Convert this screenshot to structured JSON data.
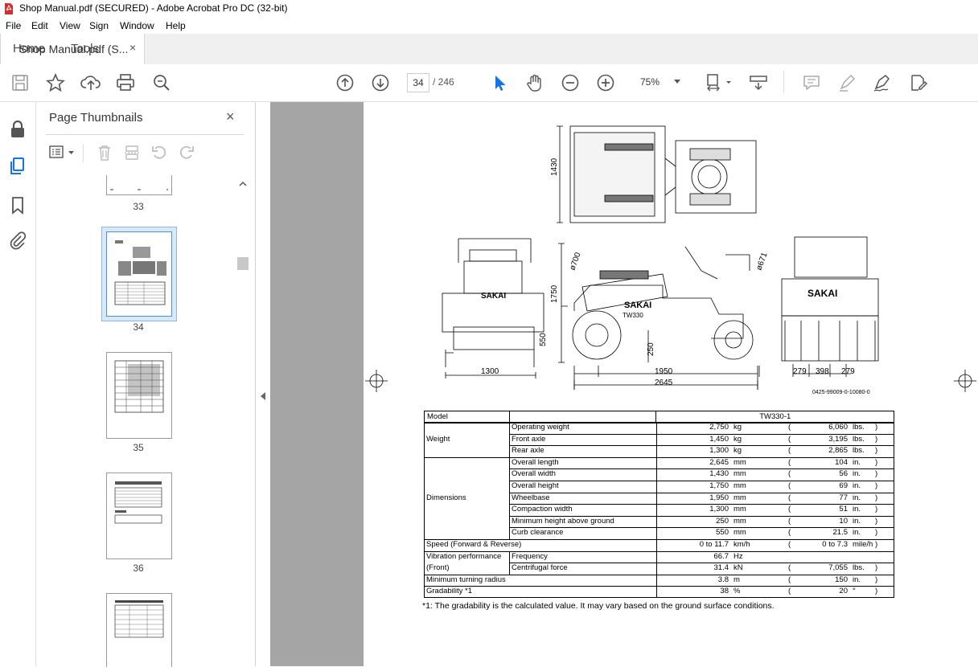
{
  "window": {
    "title": "Shop Manual.pdf (SECURED) - Adobe Acrobat Pro DC (32-bit)"
  },
  "menu": [
    "File",
    "Edit",
    "View",
    "Sign",
    "Window",
    "Help"
  ],
  "tabs": {
    "home": "Home",
    "tools": "Tools",
    "document": "Shop Manual.pdf (S...",
    "close": "×"
  },
  "toolbar": {
    "icons": [
      "save-icon",
      "star-icon",
      "upload-icon",
      "print-icon",
      "search-zoom-icon",
      "page-up-icon",
      "page-down-icon",
      "select-cursor-icon",
      "hand-icon",
      "zoom-out-icon",
      "zoom-in-icon",
      "fit-page-icon",
      "scroll-mode-icon",
      "comment-icon",
      "highlight-icon",
      "sign-icon",
      "share-icon"
    ],
    "current_page": "34",
    "total_pages": "/ 246",
    "zoom": "75%"
  },
  "thumbnails_panel": {
    "title": "Page Thumbnails",
    "close": "×",
    "pages": [
      "33",
      "34",
      "35",
      "36"
    ],
    "selected_page": "34"
  },
  "document": {
    "drawing": {
      "dims": {
        "d1430": "1430",
        "d1750": "1750",
        "d550": "550",
        "d250": "250",
        "d1300": "1300",
        "d1950": "1950",
        "d2645": "2645",
        "d279a": "279",
        "d398": "398",
        "d279b": "279",
        "d700": "ø700",
        "d671": "ø671"
      },
      "brand": "SAKAI",
      "model_mark": "TW330",
      "ref": "0425-99009-0-10080-0"
    },
    "spec_table": {
      "header": {
        "label": "Model",
        "value": "TW330-1"
      },
      "rows": [
        {
          "group": "Weight",
          "item": "Operating weight",
          "value": "2,750",
          "unit": "kg",
          "paren_value": "6,060",
          "paren_unit": "lbs."
        },
        {
          "group": "",
          "item": "Front axle",
          "value": "1,450",
          "unit": "kg",
          "paren_value": "3,195",
          "paren_unit": "lbs."
        },
        {
          "group": "",
          "item": "Rear axle",
          "value": "1,300",
          "unit": "kg",
          "paren_value": "2,865",
          "paren_unit": "lbs."
        },
        {
          "group": "Dimensions",
          "item": "Overall length",
          "value": "2,645",
          "unit": "mm",
          "paren_value": "104",
          "paren_unit": "in."
        },
        {
          "group": "",
          "item": "Overall width",
          "value": "1,430",
          "unit": "mm",
          "paren_value": "56",
          "paren_unit": "in."
        },
        {
          "group": "",
          "item": "Overall height",
          "value": "1,750",
          "unit": "mm",
          "paren_value": "69",
          "paren_unit": "in."
        },
        {
          "group": "",
          "item": "Wheelbase",
          "value": "1,950",
          "unit": "mm",
          "paren_value": "77",
          "paren_unit": "in."
        },
        {
          "group": "",
          "item": "Compaction width",
          "value": "1,300",
          "unit": "mm",
          "paren_value": "51",
          "paren_unit": "in."
        },
        {
          "group": "",
          "item": "Minimum height above ground",
          "value": "250",
          "unit": "mm",
          "paren_value": "10",
          "paren_unit": "in."
        },
        {
          "group": "",
          "item": "Curb clearance",
          "value": "550",
          "unit": "mm",
          "paren_value": "21.5",
          "paren_unit": "in."
        }
      ],
      "speed": {
        "label": "Speed (Forward & Reverse)",
        "value": "0 to 11.7",
        "unit": "km/h",
        "paren_value": "0 to 7.3",
        "paren_unit": "mile/h"
      },
      "vibration": {
        "label1": "Vibration performance",
        "label2": "(Front)",
        "frequency": {
          "item": "Frequency",
          "value": "66.7",
          "unit": "Hz"
        },
        "centrifugal": {
          "item": "Centrifugal force",
          "value": "31.4",
          "unit": "kN",
          "paren_value": "7,055",
          "paren_unit": "lbs."
        }
      },
      "turning": {
        "label": "Minimum turning radius",
        "value": "3.8",
        "unit": "m",
        "paren_value": "150",
        "paren_unit": "in."
      },
      "gradability": {
        "label": "Gradability *1",
        "value": "38",
        "unit": "%",
        "paren_value": "20",
        "paren_unit": "°"
      }
    },
    "footnote": "*1: The gradability is the calculated value. It may vary based on the ground surface conditions."
  }
}
